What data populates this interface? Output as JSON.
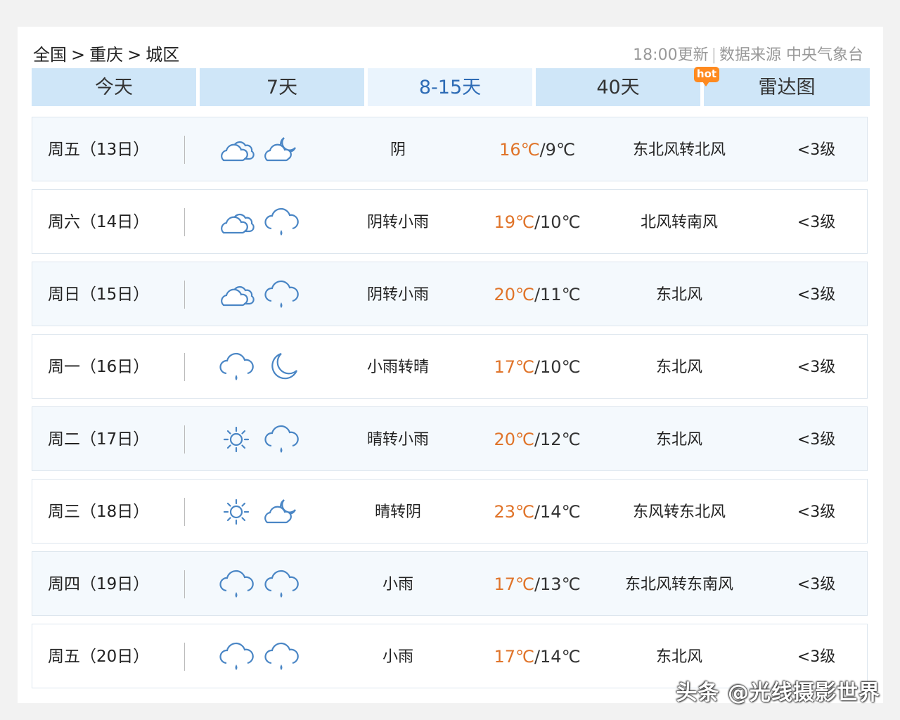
{
  "breadcrumb": [
    "全国",
    "重庆",
    "城区"
  ],
  "breadcrumb_sep": ">",
  "update": "18:00更新",
  "source": "数据来源 中央气象台",
  "tabs": [
    {
      "label": "今天"
    },
    {
      "label": "7天"
    },
    {
      "label": "8-15天"
    },
    {
      "label": "40天",
      "badge": "hot"
    },
    {
      "label": "雷达图"
    }
  ],
  "colors": {
    "accent": "#2d6bb5",
    "temp_high": "#e0742a",
    "tab_bg": "#cfe6f8",
    "hot_badge": "#ff8a1f"
  },
  "days": [
    {
      "date": "周五（13日）",
      "icons": [
        "cloudy-icon",
        "partly-cloudy-night-icon"
      ],
      "weather": "阴",
      "high": "16℃",
      "low": "/9℃",
      "wind": "东北风转北风",
      "level": "<3级"
    },
    {
      "date": "周六（14日）",
      "icons": [
        "cloudy-icon",
        "light-rain-icon"
      ],
      "weather": "阴转小雨",
      "high": "19℃",
      "low": "/10℃",
      "wind": "北风转南风",
      "level": "<3级"
    },
    {
      "date": "周日（15日）",
      "icons": [
        "cloudy-icon",
        "light-rain-icon"
      ],
      "weather": "阴转小雨",
      "high": "20℃",
      "low": "/11℃",
      "wind": "东北风",
      "level": "<3级"
    },
    {
      "date": "周一（16日）",
      "icons": [
        "light-rain-icon",
        "moon-icon"
      ],
      "weather": "小雨转晴",
      "high": "17℃",
      "low": "/10℃",
      "wind": "东北风",
      "level": "<3级"
    },
    {
      "date": "周二（17日）",
      "icons": [
        "sun-icon",
        "light-rain-icon"
      ],
      "weather": "晴转小雨",
      "high": "20℃",
      "low": "/12℃",
      "wind": "东北风",
      "level": "<3级"
    },
    {
      "date": "周三（18日）",
      "icons": [
        "sun-icon",
        "partly-cloudy-night-icon"
      ],
      "weather": "晴转阴",
      "high": "23℃",
      "low": "/14℃",
      "wind": "东风转东北风",
      "level": "<3级"
    },
    {
      "date": "周四（19日）",
      "icons": [
        "light-rain-icon",
        "light-rain-icon"
      ],
      "weather": "小雨",
      "high": "17℃",
      "low": "/13℃",
      "wind": "东北风转东南风",
      "level": "<3级"
    },
    {
      "date": "周五（20日）",
      "icons": [
        "light-rain-icon",
        "light-rain-icon"
      ],
      "weather": "小雨",
      "high": "17℃",
      "low": "/14℃",
      "wind": "东北风",
      "level": "<3级"
    }
  ],
  "watermark": "头条 @光线摄影世界"
}
